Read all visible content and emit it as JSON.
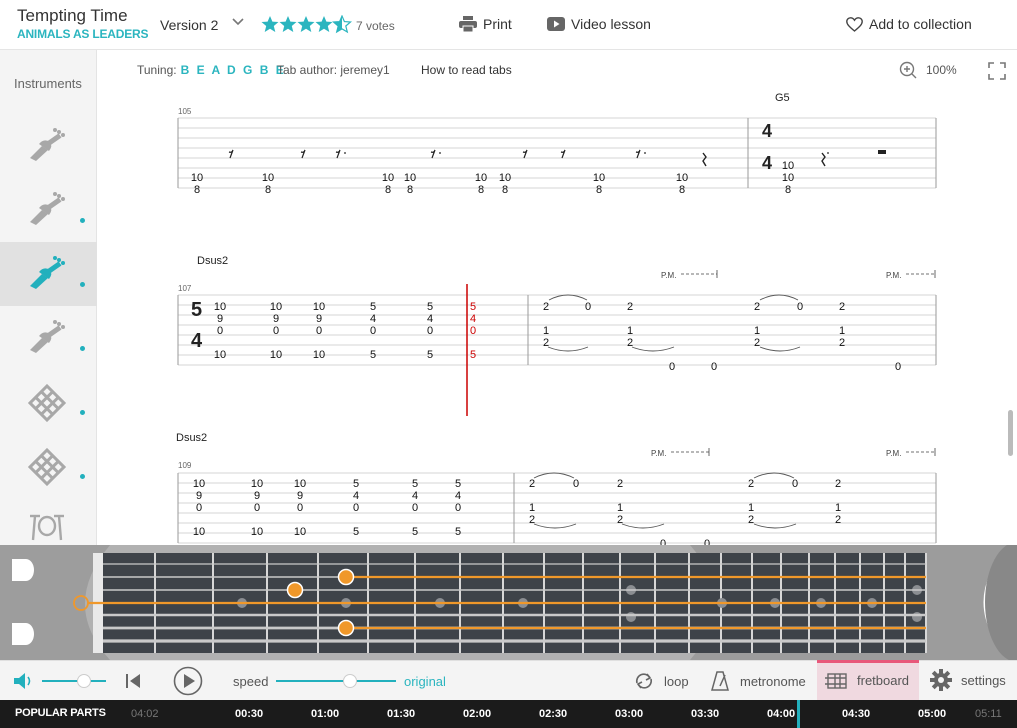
{
  "header": {
    "song_title": "Tempting Time",
    "artist": "ANIMALS AS LEADERS",
    "version": "Version 2",
    "rating": 4.5,
    "votes": "7 votes",
    "print_label": "Print",
    "video_label": "Video lesson",
    "collection_label": "Add to collection"
  },
  "sidebar": {
    "label": "Instruments",
    "instruments": [
      {
        "icon": "electric-guitar-icon",
        "active": false,
        "dot": false
      },
      {
        "icon": "electric-guitar-icon",
        "active": false,
        "dot": true
      },
      {
        "icon": "electric-guitar-icon",
        "active": true,
        "dot": true
      },
      {
        "icon": "electric-guitar-icon",
        "active": false,
        "dot": true
      },
      {
        "icon": "keyboard-diamond-icon",
        "active": false,
        "dot": true
      },
      {
        "icon": "keyboard-diamond-icon",
        "active": false,
        "dot": true
      },
      {
        "icon": "drum-kit-icon",
        "active": false,
        "dot": false
      }
    ]
  },
  "info": {
    "tuning_label": "Tuning:",
    "tuning": "B E A D G B E",
    "tab_author": "Tab author: jeremey1",
    "how_to_read": "How to read tabs",
    "zoom": "100%"
  },
  "score": {
    "systems": [
      {
        "measure": "105",
        "chords": [
          {
            "name": "G5"
          }
        ]
      },
      {
        "measure": "107",
        "chords": [
          {
            "name": "Dsus2"
          }
        ],
        "time_signature": "5/4",
        "pm": "P.M."
      },
      {
        "measure": "109",
        "chords": [
          {
            "name": "Dsus2"
          }
        ],
        "pm": "P.M."
      }
    ]
  },
  "controls": {
    "speed_label": "speed",
    "speed_value": "original",
    "loop_label": "loop",
    "metronome_label": "metronome",
    "fretboard_label": "fretboard",
    "settings_label": "settings"
  },
  "timeline": {
    "popular_label": "POPULAR PARTS",
    "times": [
      "04:02",
      "00:30",
      "01:00",
      "01:30",
      "02:00",
      "02:30",
      "03:00",
      "03:30",
      "04:00",
      "04:30",
      "05:00",
      "05:11"
    ]
  },
  "colors": {
    "accent": "#2bb5bf",
    "highlight": "#e8577a",
    "note": "#f0982a",
    "cursor": "#cc0000"
  }
}
